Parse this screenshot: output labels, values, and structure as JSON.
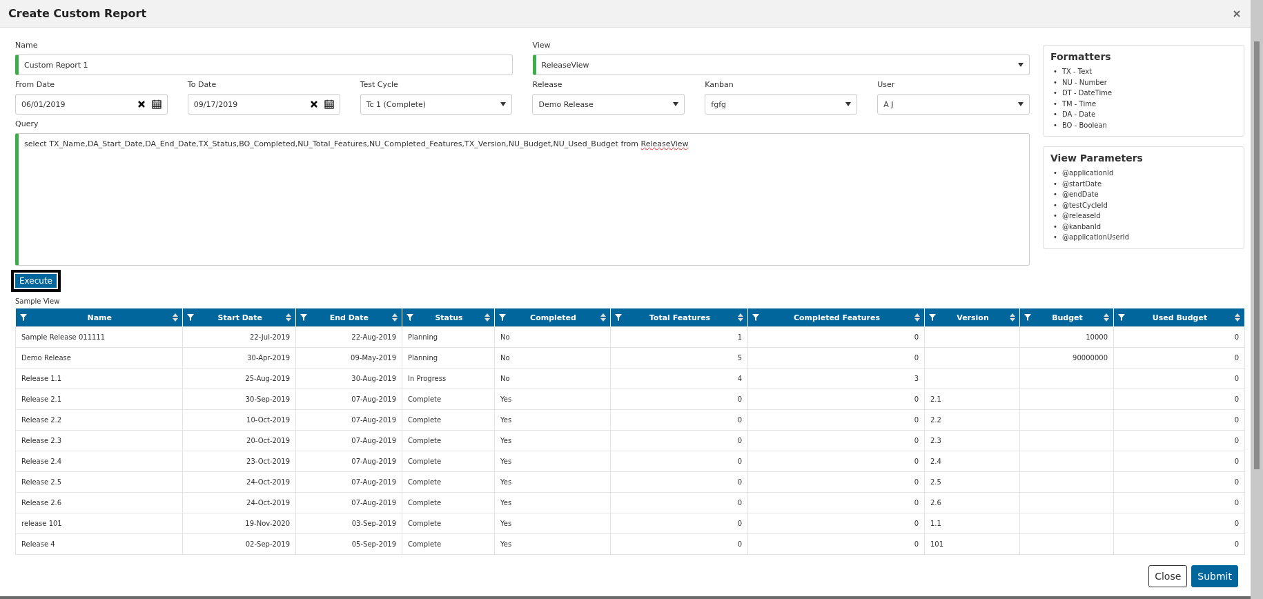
{
  "dialog": {
    "title": "Create Custom Report"
  },
  "form": {
    "name": {
      "label": "Name",
      "value": "Custom Report 1",
      "required": true
    },
    "view": {
      "label": "View",
      "value": "ReleaseView",
      "required": true
    },
    "from_date": {
      "label": "From Date",
      "value": "06/01/2019"
    },
    "to_date": {
      "label": "To Date",
      "value": "09/17/2019"
    },
    "selects": [
      {
        "label": "Test Cycle",
        "value": "Tc 1 (Complete)"
      },
      {
        "label": "Release",
        "value": "Demo Release"
      },
      {
        "label": "Kanban",
        "value": "fgfg"
      },
      {
        "label": "User",
        "value": "A J"
      }
    ],
    "query": {
      "label": "Query",
      "value_before": "select TX_Name,DA_Start_Date,DA_End_Date,TX_Status,BO_Completed,NU_Total_Features,NU_Completed_Features,TX_Version,NU_Budget,NU_Used_Budget from",
      "value_misspelled": "ReleaseView",
      "required": true
    }
  },
  "execute_button": "Execute",
  "formatters": {
    "title": "Formatters",
    "marker": "•",
    "items": [
      "TX - Text",
      "NU - Number",
      "DT - DateTime",
      "TM - Time",
      "DA - Date",
      "BO - Boolean"
    ]
  },
  "view_parameters": {
    "title": "View Parameters",
    "marker": "•",
    "items": [
      "@applicationId",
      "@startDate",
      "@endDate",
      "@testCycleId",
      "@releaseId",
      "@kanbanId",
      "@applicationUserId"
    ]
  },
  "sample_view": {
    "label": "Sample View",
    "columns": [
      {
        "title": "Name",
        "kind": "text"
      },
      {
        "title": "Start Date",
        "kind": "number"
      },
      {
        "title": "End Date",
        "kind": "number"
      },
      {
        "title": "Status",
        "kind": "text"
      },
      {
        "title": "Completed",
        "kind": "text"
      },
      {
        "title": "Total Features",
        "kind": "number"
      },
      {
        "title": "Completed Features",
        "kind": "number"
      },
      {
        "title": "Version",
        "kind": "text"
      },
      {
        "title": "Budget",
        "kind": "number"
      },
      {
        "title": "Used Budget",
        "kind": "number"
      }
    ],
    "rows": [
      [
        "Sample Release 011111",
        "22-Jul-2019",
        "22-Aug-2019",
        "Planning",
        "No",
        "1",
        "0",
        null,
        "10000",
        "0"
      ],
      [
        "Demo Release",
        "30-Apr-2019",
        "09-May-2019",
        "Planning",
        "No",
        "5",
        "0",
        null,
        "90000000",
        "0"
      ],
      [
        "Release 1.1",
        "25-Aug-2019",
        "30-Aug-2019",
        "In Progress",
        "No",
        "4",
        "3",
        null,
        null,
        "0"
      ],
      [
        "Release 2.1",
        "30-Sep-2019",
        "07-Aug-2019",
        "Complete",
        "Yes",
        "0",
        "0",
        "2.1",
        null,
        "0"
      ],
      [
        "Release 2.2",
        "10-Oct-2019",
        "07-Aug-2019",
        "Complete",
        "Yes",
        "0",
        "0",
        "2.2",
        null,
        "0"
      ],
      [
        "Release 2.3",
        "20-Oct-2019",
        "07-Aug-2019",
        "Complete",
        "Yes",
        "0",
        "0",
        "2.3",
        null,
        "0"
      ],
      [
        "Release 2.4",
        "23-Oct-2019",
        "07-Aug-2019",
        "Complete",
        "Yes",
        "0",
        "0",
        "2.4",
        null,
        "0"
      ],
      [
        "Release 2.5",
        "24-Oct-2019",
        "07-Aug-2019",
        "Complete",
        "Yes",
        "0",
        "0",
        "2.5",
        null,
        "0"
      ],
      [
        "Release 2.6",
        "24-Oct-2019",
        "07-Aug-2019",
        "Complete",
        "Yes",
        "0",
        "0",
        "2.6",
        null,
        "0"
      ],
      [
        "release 101",
        "19-Nov-2020",
        "03-Sep-2019",
        "Complete",
        "Yes",
        "0",
        "0",
        "1.1",
        null,
        "0"
      ],
      [
        "Release 4",
        "02-Sep-2019",
        "05-Sep-2019",
        "Complete",
        "Yes",
        "0",
        "0",
        "101",
        null,
        "0"
      ]
    ]
  },
  "footer_buttons": [
    {
      "label": "Close",
      "kind": "secondary"
    },
    {
      "label": "Submit",
      "kind": "primary"
    }
  ]
}
